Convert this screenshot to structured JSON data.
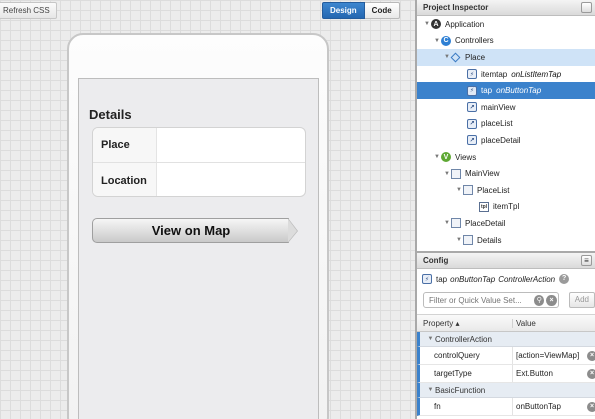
{
  "toolbar": {
    "refresh_css_label": "Refresh CSS",
    "design_label": "Design",
    "code_label": "Code"
  },
  "canvas": {
    "details_title": "Details",
    "fields": [
      {
        "label": "Place"
      },
      {
        "label": "Location"
      }
    ],
    "map_button_label": "View on Map"
  },
  "inspector": {
    "title": "Project Inspector",
    "tree": [
      {
        "label": "Application",
        "icon": "application-icon",
        "badge": "A"
      },
      {
        "label": "Controllers",
        "icon": "controllers-icon",
        "badge": "C"
      },
      {
        "label": "Place",
        "icon": "controller-diamond-icon"
      },
      {
        "label": "itemtap",
        "sub": "onListItemTap",
        "icon": "action-icon"
      },
      {
        "label": "tap",
        "sub": "onButtonTap",
        "icon": "action-icon"
      },
      {
        "label": "mainView",
        "icon": "reference-icon"
      },
      {
        "label": "placeList",
        "icon": "reference-icon"
      },
      {
        "label": "placeDetail",
        "icon": "reference-icon"
      },
      {
        "label": "Views",
        "icon": "views-icon",
        "badge": "V"
      },
      {
        "label": "MainView",
        "icon": "view-icon"
      },
      {
        "label": "PlaceList",
        "icon": "list-icon"
      },
      {
        "label": "itemTpl",
        "icon": "template-icon",
        "badge": "tpl"
      },
      {
        "label": "PlaceDetail",
        "icon": "panel-icon"
      },
      {
        "label": "Details",
        "icon": "fieldset-icon"
      }
    ]
  },
  "config": {
    "title": "Config",
    "target_name": "tap",
    "target_fn": "onButtonTap",
    "target_type": "ControllerAction",
    "filter_placeholder": "Filter or Quick Value Set...",
    "add_label": "Add",
    "col_property": "Property ▴",
    "col_value": "Value",
    "groups": [
      {
        "name": "ControllerAction",
        "props": [
          {
            "name": "controlQuery",
            "value": "[action=ViewMap]"
          },
          {
            "name": "targetType",
            "value": "Ext.Button"
          }
        ]
      },
      {
        "name": "BasicFunction",
        "props": [
          {
            "name": "fn",
            "value": "onButtonTap"
          }
        ]
      }
    ]
  }
}
